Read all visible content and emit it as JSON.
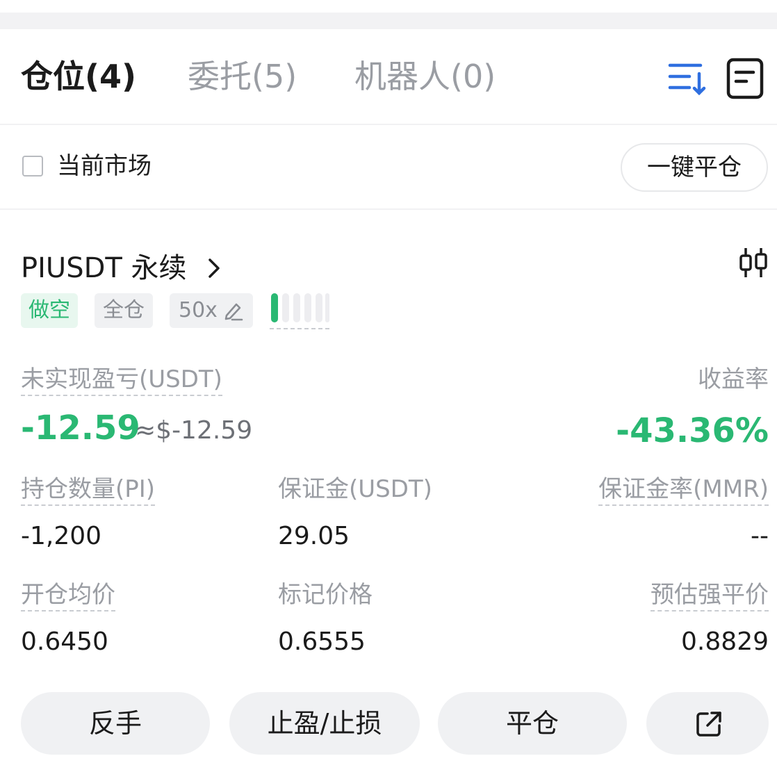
{
  "tabs": [
    {
      "label": "仓位(4)",
      "active": true
    },
    {
      "label": "委托(5)",
      "active": false
    },
    {
      "label": "机器人(0)",
      "active": false
    }
  ],
  "toolbar": {
    "sort_icon": "sort-list-icon",
    "doc_icon": "document-icon",
    "accent": "#2f6fe0"
  },
  "filter": {
    "current_market_label": "当前市场",
    "current_market_checked": false,
    "close_all_label": "一键平仓"
  },
  "position": {
    "symbol": "PIUSDT 永续",
    "side_tag": "做空",
    "margin_mode_tag": "全仓",
    "leverage_tag": "50x",
    "risk_level": {
      "filled": 1,
      "total": 6
    },
    "unrealized_pnl_label": "未实现盈亏(USDT)",
    "unrealized_pnl": "-12.59",
    "unrealized_pnl_usd": "≈$-12.59",
    "roi_label": "收益率",
    "roi": "-43.36%",
    "qty_label": "持仓数量(PI)",
    "qty": "-1,200",
    "margin_label": "保证金(USDT)",
    "margin": "29.05",
    "mmr_label": "保证金率(MMR)",
    "mmr": "--",
    "entry_label": "开仓均价",
    "entry": "0.6450",
    "mark_label": "标记价格",
    "mark": "0.6555",
    "liq_label": "预估强平价",
    "liq": "0.8829",
    "pnl_color": "#2ab873"
  },
  "actions": {
    "reverse": "反手",
    "tpsl": "止盈/止损",
    "close": "平仓",
    "share_icon": "share-icon"
  }
}
